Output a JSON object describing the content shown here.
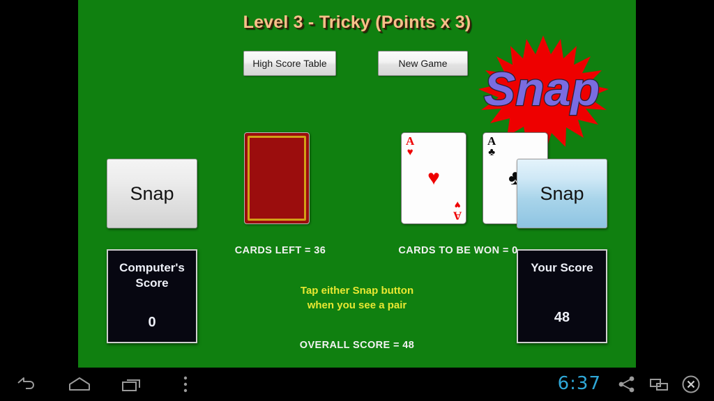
{
  "app": {
    "title": "Level 3 - Tricky (Points x 3)",
    "board_color": "#108010",
    "title_color": "#f8c08a"
  },
  "toolbar": {
    "high_score_label": "High Score Table",
    "new_game_label": "New Game"
  },
  "logo": {
    "text": "Snap",
    "burst_color": "#ee0000",
    "text_color": "#7a6ce0"
  },
  "cards": [
    {
      "id": "deck",
      "face_down": true,
      "back_color": "#9b0d0d",
      "border_color": "#d2a017"
    },
    {
      "id": "computer-card",
      "face_down": false,
      "rank": "A",
      "suit": "♥",
      "color": "red"
    },
    {
      "id": "player-card",
      "face_down": false,
      "rank": "A",
      "suit": "♣",
      "color": "black"
    }
  ],
  "snap_buttons": {
    "left_label": "Snap",
    "right_label": "Snap"
  },
  "scores": {
    "computer": {
      "line1": "Computer's",
      "line2": "Score",
      "value": "0"
    },
    "player": {
      "label": "Your Score",
      "value": "48"
    }
  },
  "status": {
    "cards_left": "CARDS LEFT = 36",
    "cards_to_be_won": "CARDS TO BE WON = 0",
    "overall_score": "OVERALL SCORE = 48",
    "hint_line1": "Tap either Snap button",
    "hint_line2": "when you see a pair",
    "hint_color": "#e8e832"
  },
  "navbar": {
    "clock": "6:37",
    "clock_color": "#2fa8d8",
    "icons": [
      "back-icon",
      "home-icon",
      "recents-icon",
      "overflow-menu-icon",
      "share-icon",
      "window-icon",
      "close-icon"
    ]
  }
}
